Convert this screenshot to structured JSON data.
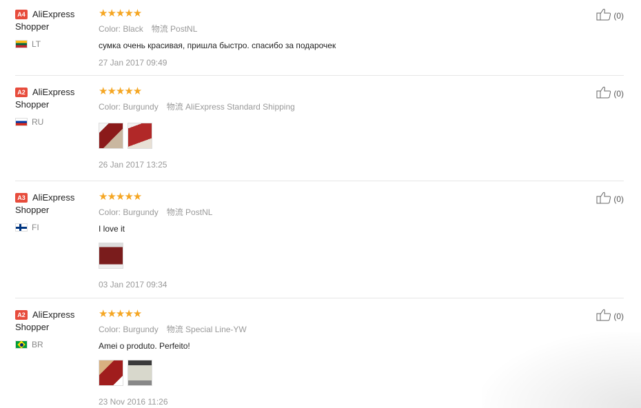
{
  "reviews": [
    {
      "level": "A4",
      "user_line1": "AliExpress",
      "user_line2": "Shopper",
      "country": "LT",
      "color": "Color: Black",
      "logistics": "物流 PostNL",
      "comment": "сумка очень красивая, пришла быстро. спасибо за подарочек",
      "date": "27 Jan 2017 09:49",
      "likes": "(0)",
      "stars": "★★★★★"
    },
    {
      "level": "A2",
      "user_line1": "AliExpress",
      "user_line2": "Shopper",
      "country": "RU",
      "color": "Color: Burgundy",
      "logistics": "物流 AliExpress Standard Shipping",
      "comment": "",
      "date": "26 Jan 2017 13:25",
      "likes": "(0)",
      "stars": "★★★★★"
    },
    {
      "level": "A3",
      "user_line1": "AliExpress",
      "user_line2": "Shopper",
      "country": "FI",
      "color": "Color: Burgundy",
      "logistics": "物流 PostNL",
      "comment": "I love it",
      "date": "03 Jan 2017 09:34",
      "likes": "(0)",
      "stars": "★★★★★"
    },
    {
      "level": "A2",
      "user_line1": "AliExpress",
      "user_line2": "Shopper",
      "country": "BR",
      "color": "Color: Burgundy",
      "logistics": "物流 Special Line-YW",
      "comment": "Amei o produto. Perfeito!",
      "date": "23 Nov 2016 11:26",
      "likes": "(0)",
      "stars": "★★★★★"
    }
  ],
  "colors": {
    "star": "#f5a623",
    "badge": "#e74c3c",
    "meta_text": "#999999"
  }
}
